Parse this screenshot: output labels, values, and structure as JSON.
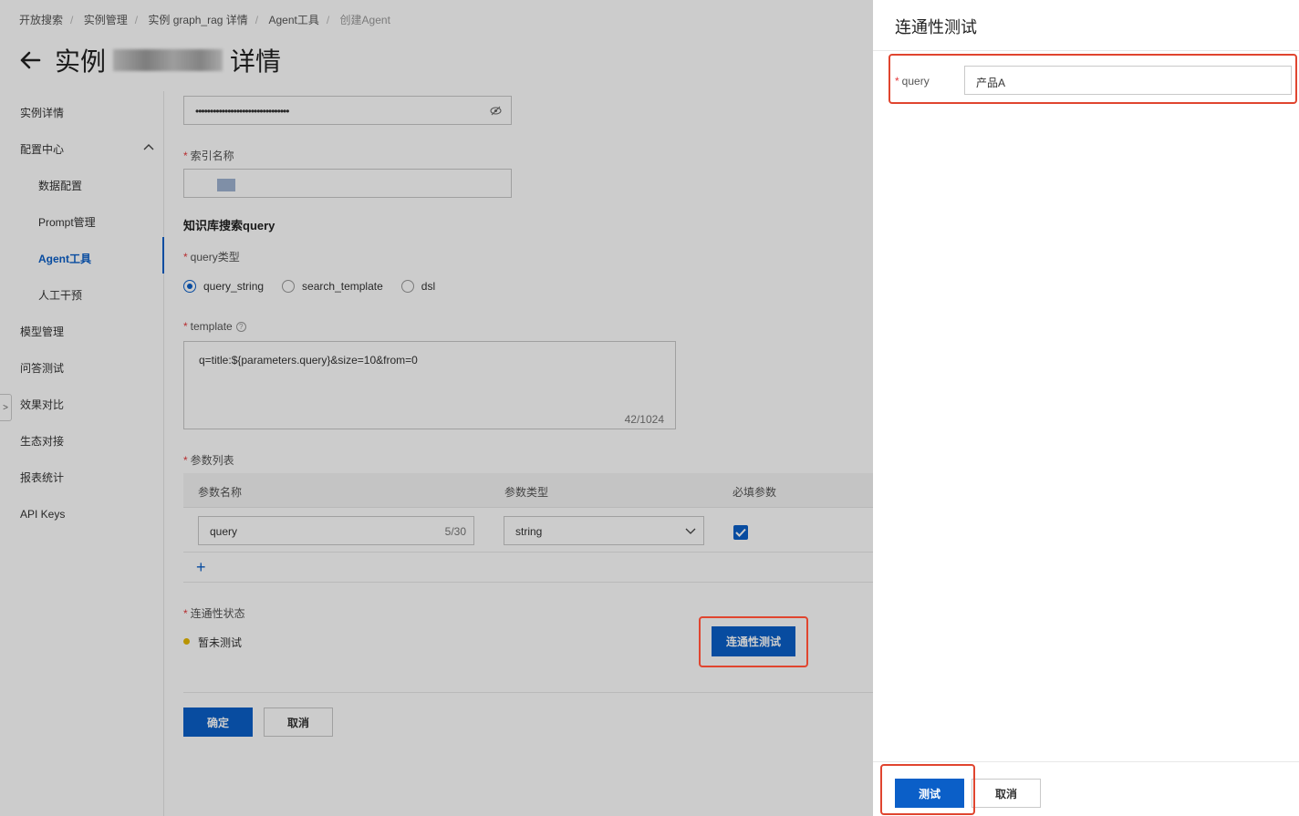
{
  "breadcrumb": [
    "开放搜索",
    "实例管理",
    "实例 graph_rag 详情",
    "Agent工具",
    "创建Agent"
  ],
  "page": {
    "title_prefix": "实例",
    "title_suffix": "详情"
  },
  "sidebar": {
    "items": [
      {
        "label": "实例详情"
      },
      {
        "label": "配置中心"
      },
      {
        "label": "数据配置"
      },
      {
        "label": "Prompt管理"
      },
      {
        "label": "Agent工具"
      },
      {
        "label": "人工干预"
      },
      {
        "label": "模型管理"
      },
      {
        "label": "问答测试"
      },
      {
        "label": "效果对比"
      },
      {
        "label": "生态对接"
      },
      {
        "label": "报表统计"
      },
      {
        "label": "API Keys"
      }
    ]
  },
  "form": {
    "password_dots": "••••••••••••••••••••••••••••••••",
    "index_name_label": "索引名称",
    "kb_search_title": "知识库搜索query",
    "query_type_label": "query类型",
    "query_type_options": [
      "query_string",
      "search_template",
      "dsl"
    ],
    "query_type_selected": "query_string",
    "template_label": "template",
    "template_value": "q=title:${parameters.query}&size=10&from=0",
    "template_counter": "42/1024",
    "params_label": "参数列表",
    "params_columns": [
      "参数名称",
      "参数类型",
      "必填参数"
    ],
    "params_rows": [
      {
        "name": "query",
        "name_counter": "5/30",
        "type": "string",
        "required": true
      }
    ],
    "connectivity_label": "连通性状态",
    "connectivity_status": "暂未测试",
    "connectivity_button": "连通性测试",
    "confirm_button": "确定",
    "cancel_button": "取消"
  },
  "drawer": {
    "title": "连通性测试",
    "query_label": "query",
    "query_value": "产品A",
    "test_button": "测试",
    "cancel_button": "取消"
  },
  "colors": {
    "primary": "#0b5fc8",
    "highlight": "#e0452f",
    "required_star": "#e4393c",
    "status_dot": "#e6b800"
  }
}
